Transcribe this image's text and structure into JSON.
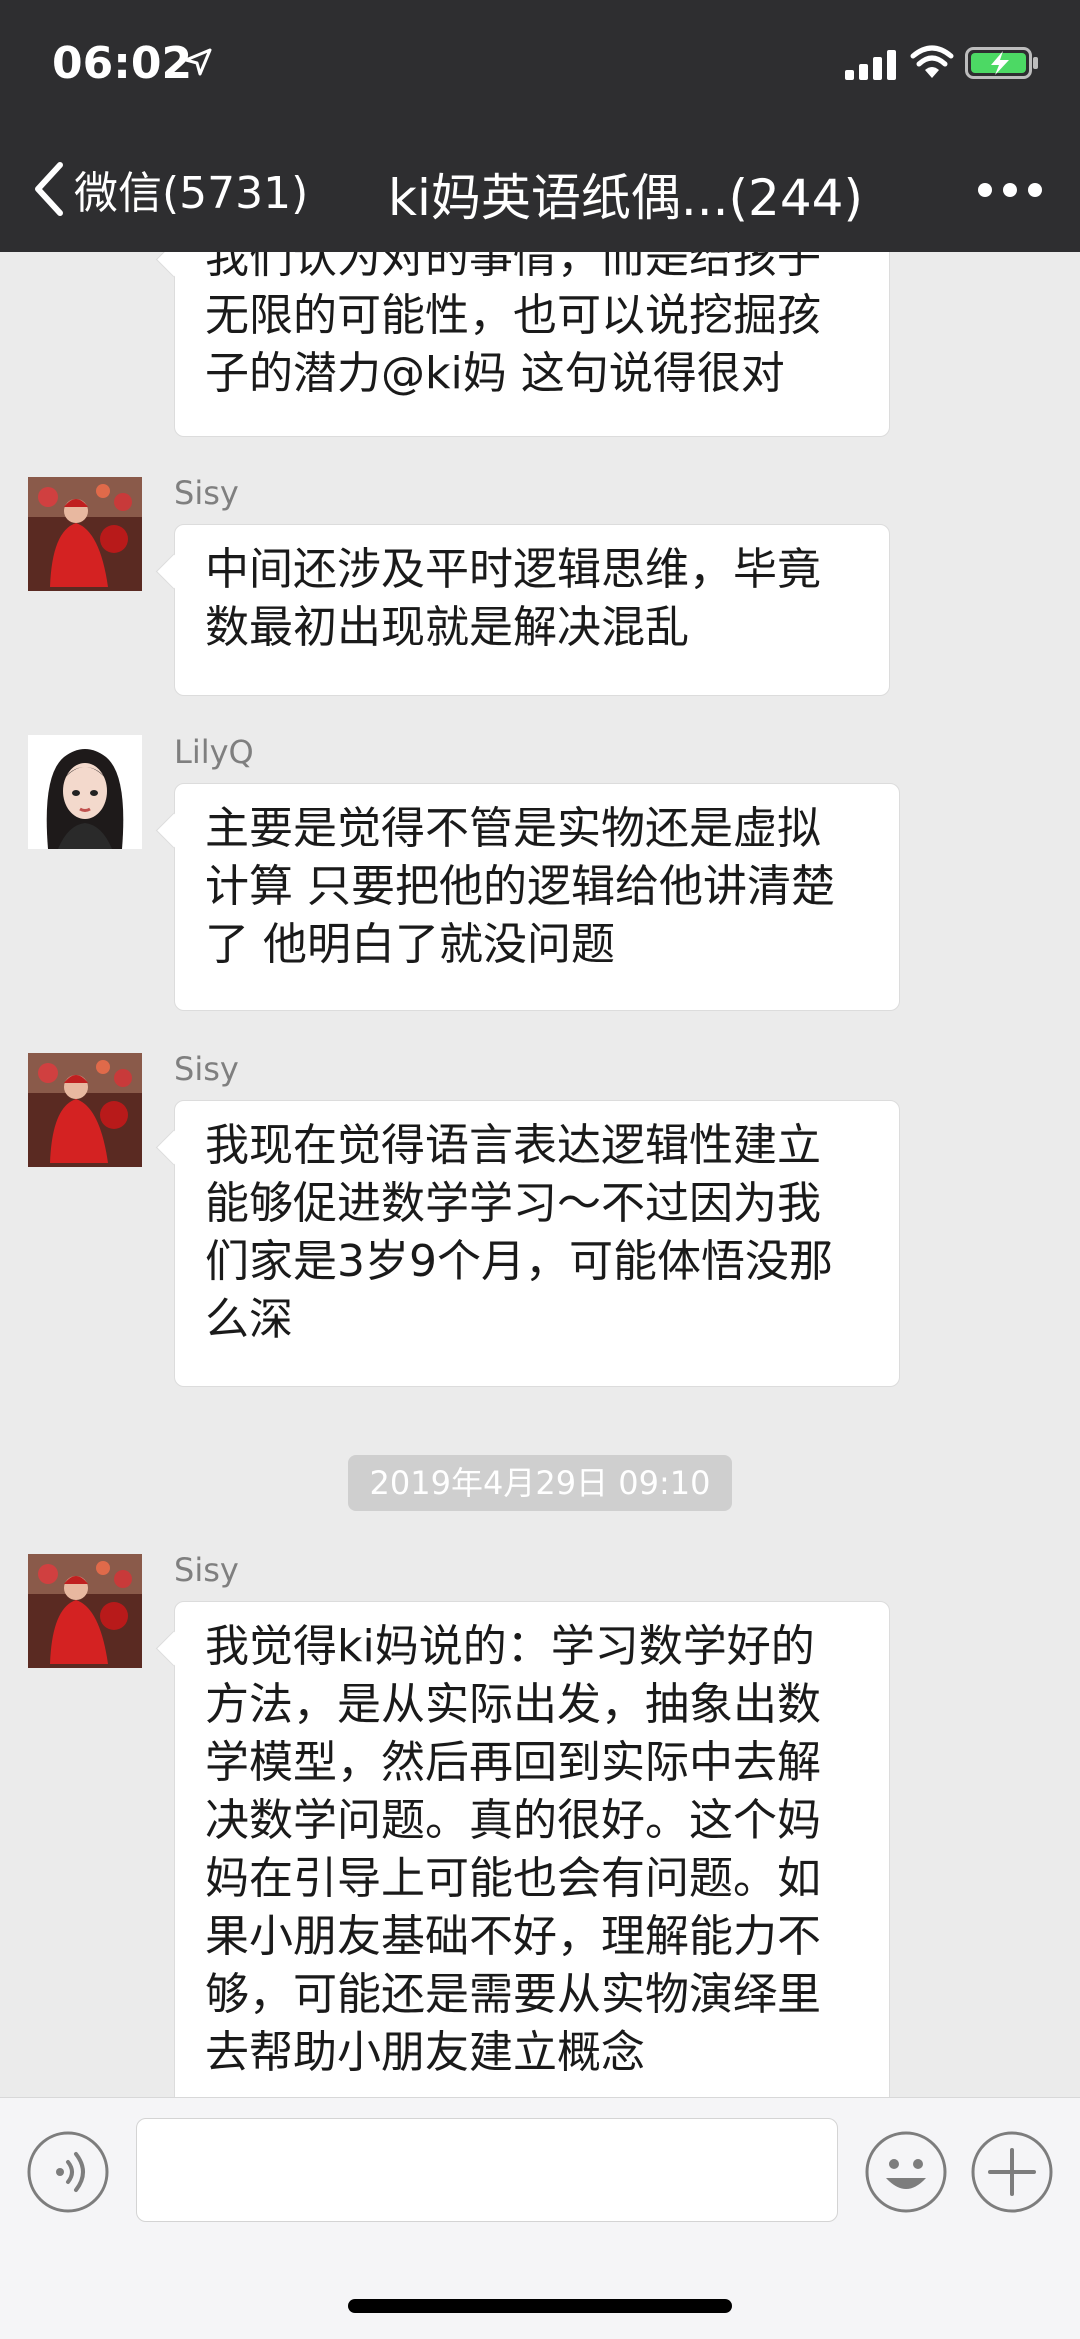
{
  "status_bar": {
    "time": "06:02"
  },
  "nav": {
    "back_label": "微信(5731)",
    "title": "ki妈英语纸偶...(244)"
  },
  "messages": [
    {
      "sender": "",
      "lines": [
        "我们认为对的事情，而是给孩子",
        "无限的可能性，也可以说挖掘孩",
        "子的潜力@ki妈 这句说得很对"
      ]
    },
    {
      "sender": "Sisy",
      "lines": [
        "中间还涉及平时逻辑思维，毕竟",
        "数最初出现就是解决混乱"
      ]
    },
    {
      "sender": "LilyQ",
      "lines": [
        "主要是觉得不管是实物还是虚拟",
        "计算 只要把他的逻辑给他讲清楚",
        "了 他明白了就没问题"
      ]
    },
    {
      "sender": "Sisy",
      "lines": [
        "我现在觉得语言表达逻辑性建立",
        "能够促进数学学习～不过因为我",
        "们家是3岁9个月，可能体悟没那",
        "么深"
      ]
    },
    {
      "sender": "Sisy",
      "lines": [
        "我觉得ki妈说的：学习数学好的",
        "方法，是从实际出发，抽象出数",
        "学模型，然后再回到实际中去解",
        "决数学问题。真的很好。这个妈",
        "妈在引导上可能也会有问题。如",
        "果小朋友基础不好，理解能力不",
        "够，可能还是需要从实物演绎里",
        "去帮助小朋友建立概念"
      ]
    }
  ],
  "timestamp": "2019年4月29日 09:10",
  "input": {
    "value": ""
  },
  "colors": {
    "header_bg": "#2e2e30",
    "chat_bg": "#ebebeb",
    "bubble_bg": "#ffffff",
    "battery_green": "#4cd964"
  }
}
